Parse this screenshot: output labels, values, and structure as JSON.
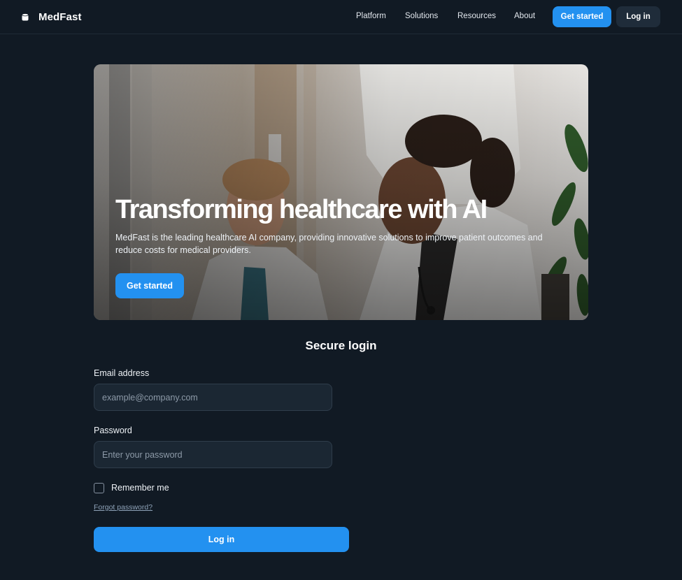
{
  "header": {
    "brand_name": "MedFast",
    "brand_icon": "medical-cylinder-icon",
    "nav": {
      "platform": "Platform",
      "solutions": "Solutions",
      "resources": "Resources",
      "about": "About"
    },
    "cta_label": "Get started",
    "login_label": "Log in"
  },
  "hero": {
    "title": "Transforming healthcare with AI",
    "subtitle": "MedFast is the leading healthcare AI company, providing innovative solutions to improve patient outcomes and reduce costs for medical providers.",
    "button_label": "Get started"
  },
  "login": {
    "title": "Secure login",
    "email_label": "Email address",
    "email_placeholder": "example@company.com",
    "email_value": "",
    "password_label": "Password",
    "password_placeholder": "Enter your password",
    "password_value": "",
    "remember_label": "Remember me",
    "remember_checked": false,
    "forgot_label": "Forgot password?",
    "submit_label": "Log in"
  },
  "colors": {
    "background": "#111a24",
    "accent": "#2391f0",
    "input_bg": "#1b2733",
    "secondary_button": "#1f2c3a"
  }
}
